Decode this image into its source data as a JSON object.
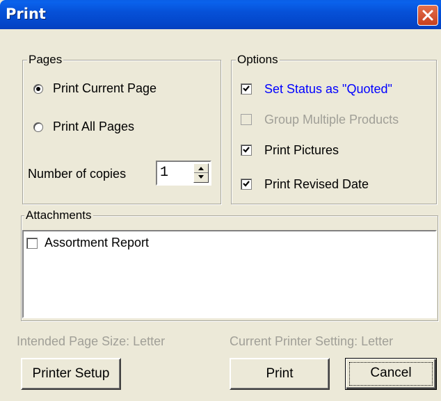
{
  "window": {
    "title": "Print"
  },
  "pages": {
    "legend": "Pages",
    "radio_current_label": "Print Current Page",
    "radio_current_selected": true,
    "radio_all_label": "Print All Pages",
    "radio_all_selected": false,
    "copies_label": "Number of copies",
    "copies_value": "1"
  },
  "options": {
    "legend": "Options",
    "items": [
      {
        "label": "Set Status as \"Quoted\"",
        "checked": true,
        "enabled": true,
        "color": "#0000ff"
      },
      {
        "label": "Group Multiple Products",
        "checked": false,
        "enabled": false,
        "color": "#a09f97"
      },
      {
        "label": "Print Pictures",
        "checked": true,
        "enabled": true,
        "color": "#000000"
      },
      {
        "label": "Print Revised Date",
        "checked": true,
        "enabled": true,
        "color": "#000000"
      }
    ]
  },
  "attachments": {
    "legend": "Attachments",
    "items": [
      {
        "label": "Assortment Report",
        "checked": false
      }
    ]
  },
  "info": {
    "intended": "Intended Page Size: Letter",
    "current": "Current Printer Setting: Letter"
  },
  "buttons": {
    "printer_setup": "Printer Setup",
    "print": "Print",
    "cancel": "Cancel"
  }
}
